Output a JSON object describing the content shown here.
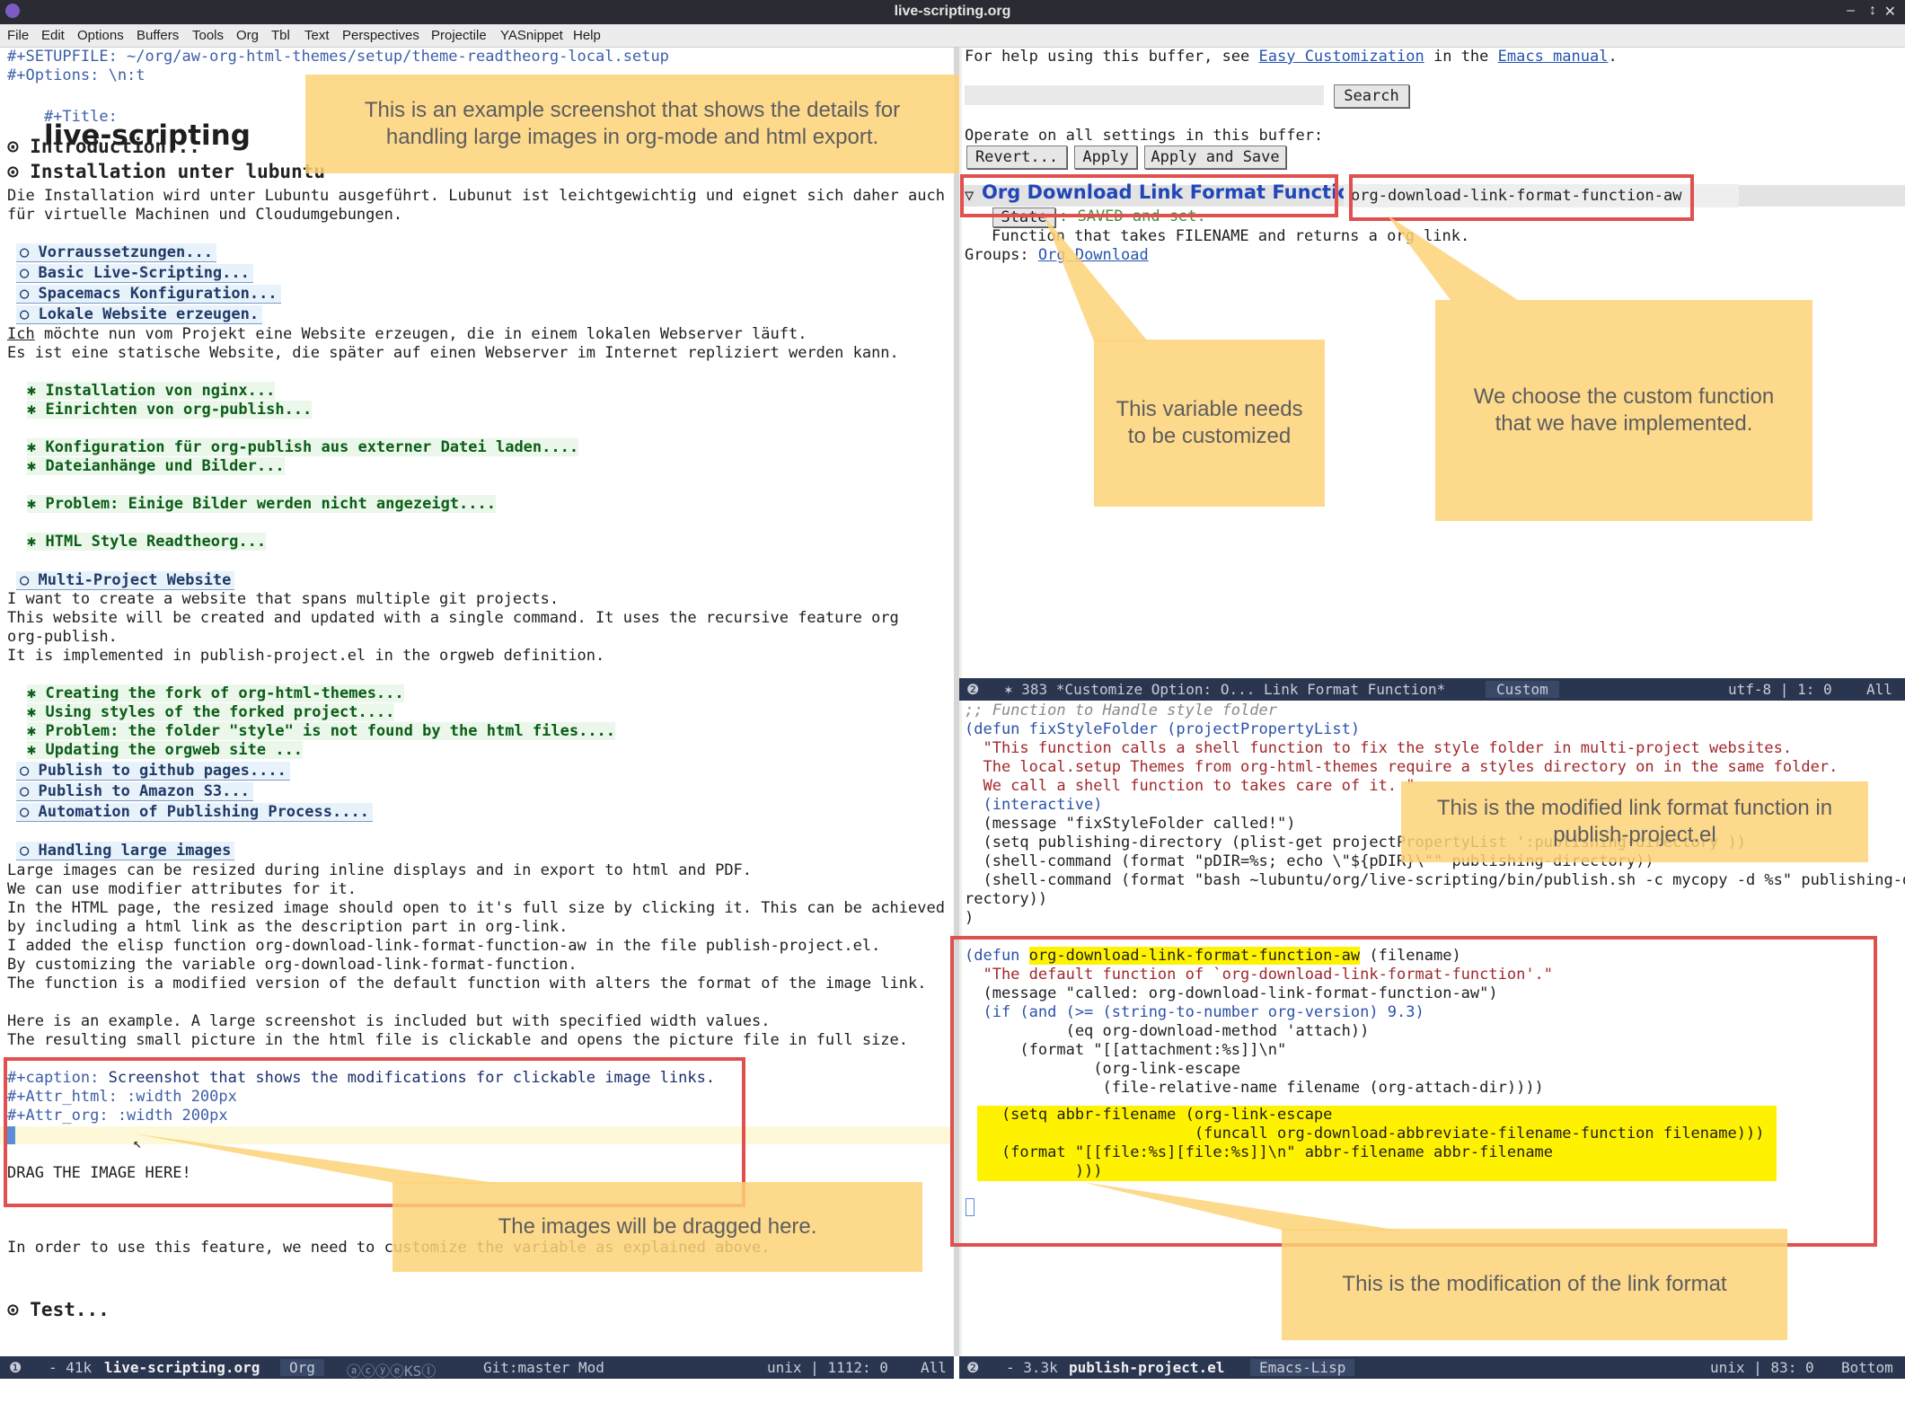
{
  "window": {
    "title": "live-scripting.org"
  },
  "menu": [
    "File",
    "Edit",
    "Options",
    "Buffers",
    "Tools",
    "Org",
    "Tbl",
    "Text",
    "Perspectives",
    "Projectile",
    "YASnippet",
    "Help"
  ],
  "left": {
    "setup": "#+SETUPFILE: ~/org/aw-org-html-themes/setup/theme-readtheorg-local.setup",
    "options": "#+Options: \\n:t",
    "title_key": "#+Title:",
    "title_val": "live-scripting",
    "h_intro": "⊙ Introduction...",
    "h_install": "⊙ Installation unter lubuntu",
    "p1": "Die Installation wird unter Lubuntu ausgeführt. Lubunut ist leichtgewichtig und eignet sich daher auch",
    "p2": "für virtuelle Machinen und Cloudumgebungen.",
    "sub1": "○ Vorraussetzungen...",
    "sub2": "○ Basic Live-Scripting...",
    "sub3": "○ Spacemacs Konfiguration...",
    "sub4": "○ Lokale Website erzeugen.",
    "p3a": "Ich",
    "p3b": " möchte nun vom Projekt eine Website erzeugen, die in einem lokalen Webserver läuft.",
    "p4": "Es ist eine statische Website, die später auf einen Webserver im Internet repliziert werden kann.",
    "s1": "✱ Installation von nginx...",
    "s2": "✱ Einrichten von org-publish...",
    "s3": "✱ Konfiguration für org-publish aus externer Datei laden....",
    "s4": "✱ Dateianhänge und Bilder...",
    "s5": "✱ Problem: Einige Bilder werden nicht angezeigt....",
    "s6": "✱ HTML Style Readtheorg...",
    "sub5": "○ Multi-Project Website",
    "p5": "I want to create a website that spans multiple git projects.",
    "p6": "This website will be created and updated with a single command. It uses the recursive feature org",
    "p7": "org-publish.",
    "p8": "It is implemented in publish-project.el in the orgweb definition.",
    "s7": "✱ Creating the fork of org-html-themes...",
    "s8": "✱ Using styles of the forked project....",
    "s9": "✱ Problem: the folder \"style\" is not found by the html files....",
    "s10": "✱ Updating the orgweb site ...",
    "sub6": "○ Publish to github pages....",
    "sub7": "○ Publish to Amazon S3...",
    "sub8": "○ Automation of Publishing Process....",
    "sub9": "○ Handling large images",
    "p9": "Large images can be resized during inline displays and in export to html and PDF.",
    "p10": "We can use modifier attributes for it.",
    "p11": "In the HTML page, the resized image should open to it's full size by clicking it. This can be achieved",
    "p12": "by including a html link as the description part in org-link.",
    "p13": "I added the elisp function org-download-link-format-function-aw in the file publish-project.el.",
    "p14": "By customizing the variable org-download-link-format-function.",
    "p15": "The function is a modified version of the default function with alters the format of the image link.",
    "p16": "Here is an example. A large screenshot is included but with specified width values.",
    "p17": "The resulting small picture in the html file is clickable and opens the picture file in full size.",
    "cap_key": "#+caption:",
    "cap_val": " Screenshot that shows the modifications for clickable image links.",
    "attr_html": "#+Attr_html: :width 200px",
    "attr_org": "#+Attr_org: :width 200px",
    "drag": "DRAG THE IMAGE HERE!",
    "p18": "In order to use this feature, we need to customize the variable as explained above.",
    "h_test": "⊙ Test..."
  },
  "right": {
    "help_pre": "For help using this buffer, see ",
    "help_link1": "Easy Customization",
    "help_mid": " in the ",
    "help_link2": "Emacs manual",
    "help_end": ".",
    "search_btn": "Search",
    "operate": "Operate on all settings in this buffer:",
    "btn_revert": "Revert...",
    "btn_apply": "Apply",
    "btn_apply_save": "Apply and Save",
    "opt_title": "Org Download Link Format Function",
    "opt_value": "org-download-link-format-function-aw",
    "state_btn": "State",
    "state_text": ": SAVED and set.",
    "doc": "Function that takes FILENAME and returns a org link.",
    "groups_label": "Groups: ",
    "groups_link": "Org Download",
    "code_comment": ";; Function to Handle style folder",
    "c1": "(defun fixStyleFolder (projectPropertyList)",
    "c2": "  \"This function calls a shell function to fix the style folder in multi-project websites.",
    "c3": "  The local.setup Themes from org-html-themes require a styles directory on in the same folder.",
    "c4": "  We call a shell function to takes care of it. \"",
    "c5": "  (interactive)",
    "c6": "  (message \"fixStyleFolder called!\")",
    "c7": "  (setq publishing-directory (plist-get projectPropertyList ':publishing-directory ))",
    "c8": "  (shell-command (format \"pDIR=%s; echo \\\"${pDIR}\\\"\" publishing-directory))",
    "c9": "  (shell-command (format \"bash ~lubuntu/org/live-scripting/bin/publish.sh -c mycopy -d %s\" publishing-di",
    "c10": "rectory))",
    "c11": ")",
    "d1a": "(defun ",
    "d1b": "org-download-link-format-function-aw",
    "d1c": " (filename)",
    "d2": "  \"The default function of `org-download-link-format-function'.\"",
    "d3": "  (message \"called: org-download-link-format-function-aw\")",
    "d4": "  (if (and (>= (string-to-number org-version) 9.3)",
    "d5": "           (eq org-download-method 'attach))",
    "d6": "      (format \"[[attachment:%s]]\\n\"",
    "d7": "              (org-link-escape",
    "d8": "               (file-relative-name filename (org-attach-dir))))",
    "d9": "    (setq abbr-filename (org-link-escape",
    "d10": "                         (funcall org-download-abbreviate-filename-function filename)))",
    "d11": "    (format \"[[file:%s][file:%s]]\\n\" abbr-filename abbr-filename",
    "d12": "            )))"
  },
  "modelines": {
    "top_right": {
      "buf": "✶ 383 *Customize Option: O... Link Format Function*",
      "mode": "Custom",
      "enc": "utf-8 | 1: 0",
      "pos": "All"
    },
    "left": {
      "size": "- 41k",
      "buf": "live-scripting.org",
      "mode": "Org",
      "minor": "ⓐⓒⓨⓔKSⓛ",
      "git": "Git:master Mod",
      "enc": "unix | 1112: 0",
      "pos": "All"
    },
    "bottom_right": {
      "size": "- 3.3k",
      "buf": "publish-project.el",
      "mode": "Emacs-Lisp",
      "enc": "unix | 83: 0",
      "pos": "Bottom"
    }
  },
  "notes": {
    "n1": "This is an example screenshot that shows the details for handling large images in org-mode and html export.",
    "n2": "This variable needs to be customized",
    "n3": "We choose the custom function that we have implemented.",
    "n4": "This is the modified link format function in publish-project.el",
    "n5": "The images will be dragged here.",
    "n6": "This is the modification of the link format"
  }
}
